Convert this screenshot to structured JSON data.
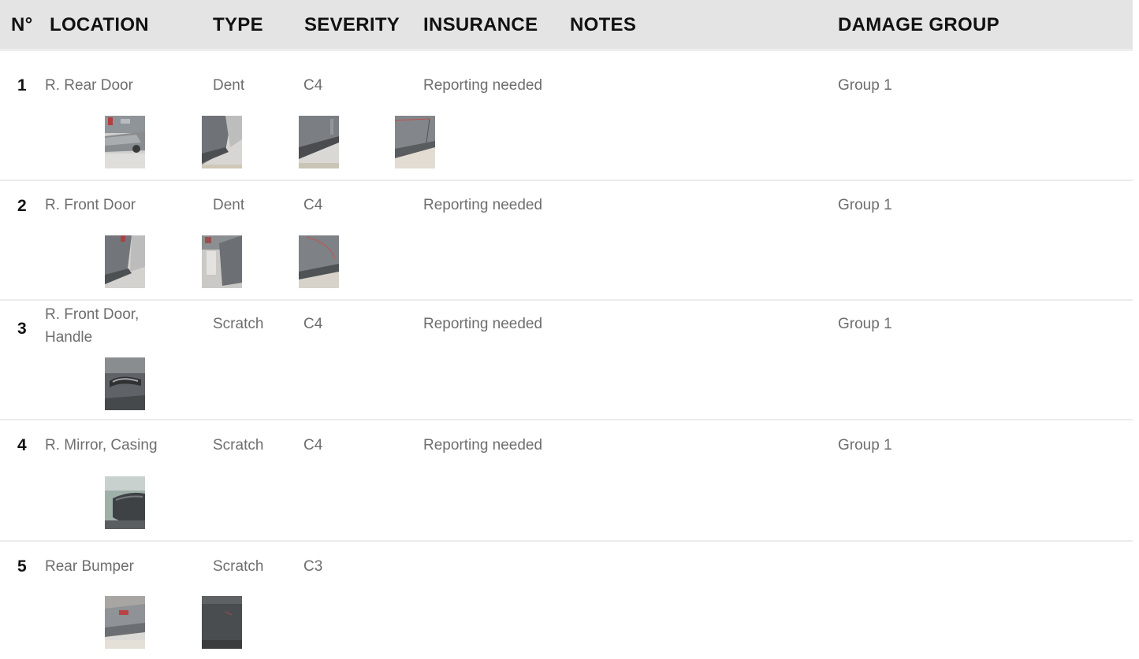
{
  "header": {
    "num": "N°",
    "location": "LOCATION",
    "type": "TYPE",
    "severity": "SEVERITY",
    "insurance": "INSURANCE",
    "notes": "NOTES",
    "damage_group": "DAMAGE GROUP"
  },
  "rows": [
    {
      "num": "1",
      "location": "R. Rear Door",
      "type": "Dent",
      "severity": "C4",
      "insurance": "Reporting needed",
      "notes": "",
      "damage_group": "Group 1",
      "photos": [
        "car-side-photo",
        "door-panel-photo",
        "door-sill-photo",
        "door-edge-photo"
      ]
    },
    {
      "num": "2",
      "location": "R. Front Door",
      "type": "Dent",
      "severity": "C4",
      "insurance": "Reporting needed",
      "notes": "",
      "damage_group": "Group 1",
      "photos": [
        "door-panel-photo",
        "garage-photo",
        "door-edge-photo"
      ]
    },
    {
      "num": "3",
      "location_line1": "R. Front Door,",
      "location_line2": "Handle",
      "type": "Scratch",
      "severity": "C4",
      "insurance": "Reporting needed",
      "notes": "",
      "damage_group": "Group 1",
      "photos": [
        "door-handle-photo"
      ]
    },
    {
      "num": "4",
      "location": "R. Mirror, Casing",
      "type": "Scratch",
      "severity": "C4",
      "insurance": "Reporting needed",
      "notes": "",
      "damage_group": "Group 1",
      "photos": [
        "mirror-photo"
      ]
    },
    {
      "num": "5",
      "location": "Rear Bumper",
      "type": "Scratch",
      "severity": "C3",
      "insurance": "",
      "notes": "",
      "damage_group": "",
      "photos": [
        "rear-car-photo",
        "dark-panel-photo"
      ]
    }
  ],
  "colors": {
    "header_bg": "#e4e4e4",
    "header_text": "#111111",
    "cell_text": "#6e6e6e",
    "separator": "#ececec"
  }
}
